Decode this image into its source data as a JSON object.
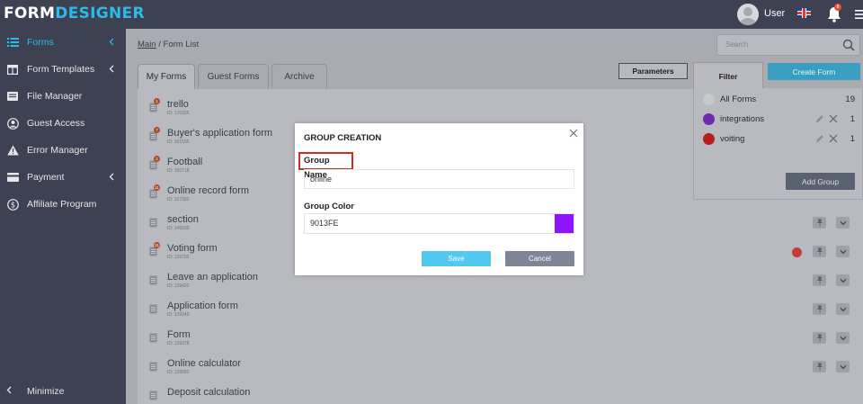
{
  "app": {
    "logo_form": "FORM",
    "logo_designer": "DESIGNER",
    "user_name": "User",
    "notification_count": "8",
    "language_flag": "uk-flag-icon"
  },
  "sidebar": {
    "items": [
      {
        "label": "Forms",
        "icon": "list-icon",
        "active": true,
        "has_chevron": true
      },
      {
        "label": "Form Templates",
        "icon": "template-icon",
        "active": false,
        "has_chevron": true
      },
      {
        "label": "File Manager",
        "icon": "folder-icon",
        "active": false,
        "has_chevron": false
      },
      {
        "label": "Guest Access",
        "icon": "user-circle-icon",
        "active": false,
        "has_chevron": false
      },
      {
        "label": "Error Manager",
        "icon": "warning-icon",
        "active": false,
        "has_chevron": false
      },
      {
        "label": "Payment",
        "icon": "card-icon",
        "active": false,
        "has_chevron": true
      },
      {
        "label": "Affiliate Program",
        "icon": "dollar-icon",
        "active": false,
        "has_chevron": false
      }
    ],
    "minimize_label": "Minimize"
  },
  "breadcrumb": {
    "main": "Main",
    "separator": " / ",
    "current": "Form List"
  },
  "search": {
    "placeholder": "Search"
  },
  "tabs": [
    {
      "label": "My Forms",
      "active": true
    },
    {
      "label": "Guest Forms",
      "active": false
    },
    {
      "label": "Archive",
      "active": false
    }
  ],
  "toolbar": {
    "parameters_label": "Parameters",
    "create_form_label": "Create Form"
  },
  "filter": {
    "title": "Filter",
    "groups": [
      {
        "label": "All Forms",
        "count": "19",
        "color": "#dcdde0",
        "editable": false
      },
      {
        "label": "integrations",
        "count": "1",
        "color": "#7b22cc",
        "editable": true
      },
      {
        "label": "voiting",
        "count": "1",
        "color": "#d01818",
        "editable": true
      }
    ],
    "add_group_label": "Add Group"
  },
  "forms": [
    {
      "name": "trello",
      "id": "ID: 170326",
      "badge": "1",
      "dot": false
    },
    {
      "name": "Buyer's application form",
      "id": "ID: 161505",
      "badge": "7",
      "dot": false
    },
    {
      "name": "Football",
      "id": "ID: 160718",
      "badge": "2",
      "dot": false
    },
    {
      "name": "Online record form",
      "id": "ID: 157393",
      "badge": "11",
      "dot": false
    },
    {
      "name": "section",
      "id": "ID: 145039",
      "badge": "",
      "dot": false
    },
    {
      "name": "Voting form",
      "id": "ID: 139792",
      "badge": "31",
      "dot": true
    },
    {
      "name": "Leave an application",
      "id": "ID: 139420",
      "badge": "",
      "dot": false
    },
    {
      "name": "Application form",
      "id": "ID: 139349",
      "badge": "",
      "dot": false
    },
    {
      "name": "Form",
      "id": "ID: 139378",
      "badge": "",
      "dot": false
    },
    {
      "name": "Online calculator",
      "id": "ID: 139050",
      "badge": "",
      "dot": false
    },
    {
      "name": "Deposit calculation",
      "id": "",
      "badge": "",
      "dot": false
    }
  ],
  "modal": {
    "title": "GROUP CREATION",
    "group_name_label": "Group Name",
    "group_name_value": "online",
    "group_color_label": "Group Color",
    "group_color_value": "9013FE",
    "group_color_hex": "#9013FE",
    "save_label": "Save",
    "cancel_label": "Cancel"
  },
  "colors": {
    "accent": "#2bbbe6",
    "sidebar": "#3d4151",
    "overlay": "#a9abb1"
  }
}
